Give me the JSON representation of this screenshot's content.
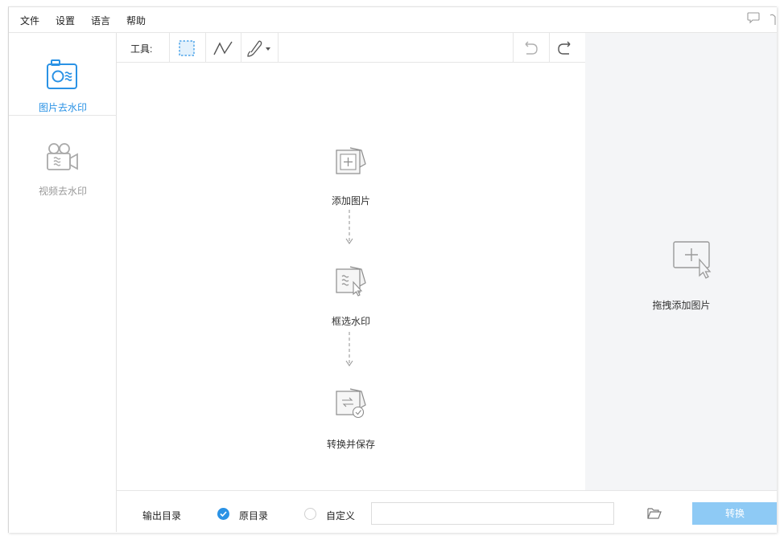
{
  "menu": {
    "file": "文件",
    "settings": "设置",
    "language": "语言",
    "help": "帮助"
  },
  "sidebar": {
    "items": [
      {
        "label": "图片去水印",
        "icon": "camera-watermark-icon",
        "active": true
      },
      {
        "label": "视频去水印",
        "icon": "video-camera-icon",
        "active": false
      }
    ]
  },
  "toolbar": {
    "label": "工具:",
    "tools": [
      "rect-select-icon",
      "polyline-icon",
      "brush-icon",
      "undo-icon",
      "redo-icon"
    ]
  },
  "steps": [
    {
      "label": "添加图片",
      "icon": "add-image-icon"
    },
    {
      "label": "框选水印",
      "icon": "select-watermark-icon"
    },
    {
      "label": "转换并保存",
      "icon": "convert-save-icon"
    }
  ],
  "dropzone": {
    "label": "拖拽添加图片"
  },
  "bottom": {
    "output_label": "输出目录",
    "option_original": "原目录",
    "option_custom": "自定义",
    "path_value": "",
    "convert_label": "转换"
  },
  "colors": {
    "accent": "#2a92e5",
    "convert_button": "#8ecaf5",
    "dropzone_bg": "#f4f5f7",
    "inactive_icon": "#aaaaaa"
  }
}
